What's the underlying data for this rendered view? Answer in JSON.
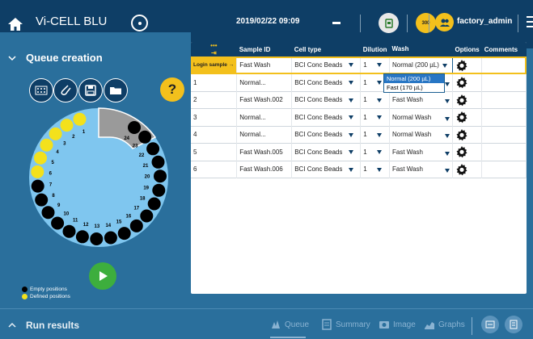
{
  "topbar": {
    "title": "Vi-CELL BLU",
    "datetime": "2019/02/22 09:09",
    "status_badge": "300",
    "username": "factory_admin"
  },
  "queue": {
    "header": "Queue creation",
    "help": "?",
    "columns": [
      "Sample ID",
      "Cell type",
      "Dilution",
      "Wash",
      "Options",
      "Comments"
    ],
    "login_label": "Login sample",
    "login_row": {
      "sample_id": "Fast Wash",
      "cell_type": "BCI Conc Beads",
      "dilution": "1",
      "wash": "Normal (200 µL)"
    },
    "rows": [
      {
        "num": "1",
        "sample_id": "Normal...",
        "cell_type": "BCI Conc Beads",
        "dilution": "1",
        "wash": ""
      },
      {
        "num": "2",
        "sample_id": "Fast Wash.002",
        "cell_type": "BCI Conc Beads",
        "dilution": "1",
        "wash": "Fast Wash"
      },
      {
        "num": "3",
        "sample_id": "Normal...",
        "cell_type": "BCI Conc Beads",
        "dilution": "1",
        "wash": "Normal Wash"
      },
      {
        "num": "4",
        "sample_id": "Normal...",
        "cell_type": "BCI Conc Beads",
        "dilution": "1",
        "wash": "Normal Wash"
      },
      {
        "num": "5",
        "sample_id": "Fast Wash.005",
        "cell_type": "BCI Conc Beads",
        "dilution": "1",
        "wash": "Fast Wash"
      },
      {
        "num": "6",
        "sample_id": "Fast Wash.006",
        "cell_type": "BCI Conc Beads",
        "dilution": "1",
        "wash": "Fast Wash"
      }
    ],
    "wash_options": [
      "Normal (200 µL)",
      "Fast (170 µL)"
    ]
  },
  "carousel": {
    "labels": [
      "1",
      "2",
      "3",
      "4",
      "5",
      "6",
      "7",
      "8",
      "9",
      "10",
      "11",
      "12",
      "13",
      "14",
      "15",
      "16",
      "17",
      "18",
      "19",
      "20",
      "21",
      "22",
      "23",
      "24"
    ]
  },
  "legend": {
    "empty": "Empty positions",
    "defined": "Defined positions"
  },
  "bottom": {
    "header": "Run results",
    "nav": [
      "Queue",
      "Summary",
      "Image",
      "Graphs"
    ]
  },
  "colors": {
    "dark_blue": "#0e3e66",
    "panel_blue": "#2a6f9c",
    "accent_yellow": "#f3c01c",
    "play_green": "#3dae3d",
    "carousel_fill": "#7fc6ef"
  }
}
